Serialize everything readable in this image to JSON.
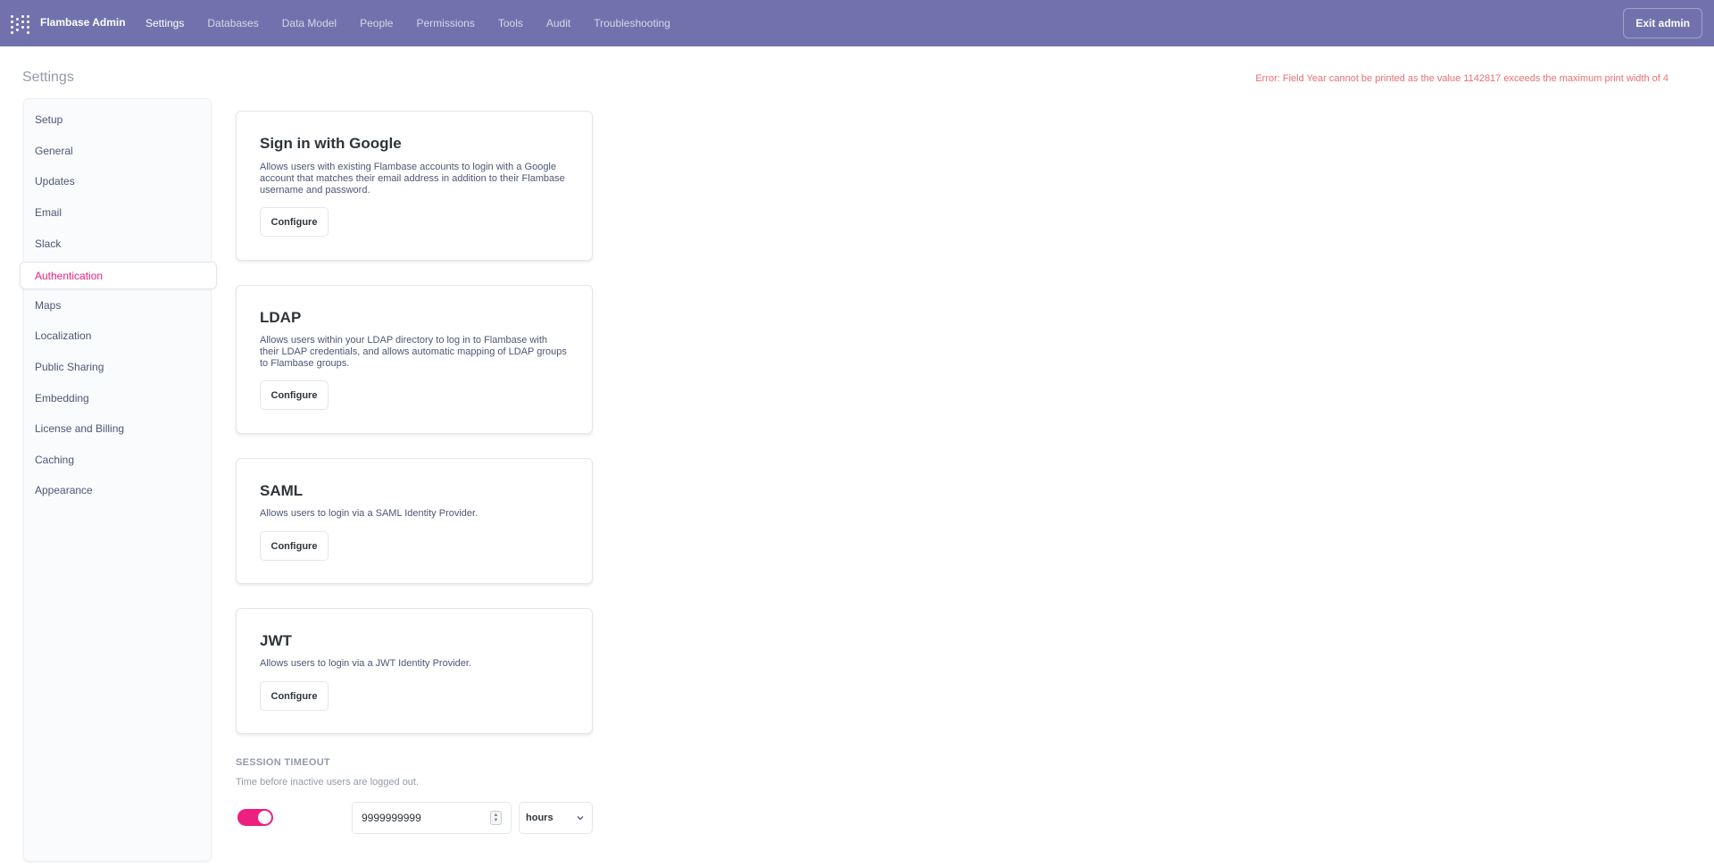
{
  "topnav": {
    "brand": "Flambase Admin",
    "links": [
      "Settings",
      "Databases",
      "Data Model",
      "People",
      "Permissions",
      "Tools",
      "Audit",
      "Troubleshooting"
    ],
    "exit_label": "Exit admin",
    "bg_color": "#7172ad"
  },
  "page": {
    "title": "Settings",
    "error": "Error: Field Year cannot be printed as the value 1142817 exceeds the maximum print width of 4"
  },
  "sidebar": {
    "items": [
      "Setup",
      "General",
      "Updates",
      "Email",
      "Slack",
      "Authentication",
      "Maps",
      "Localization",
      "Public Sharing",
      "Embedding",
      "License and Billing",
      "Caching",
      "Appearance"
    ],
    "active": "Authentication",
    "accent_color": "#ed1f7f"
  },
  "cards": [
    {
      "title": "Sign in with Google",
      "desc_lines": [
        "Allows users with existing Flambase accounts to login with a Google",
        "account that matches their email address in addition to their Flambase",
        "username and password."
      ],
      "button": "Configure"
    },
    {
      "title": "LDAP",
      "desc_lines": [
        "Allows users within your LDAP directory to log in to Flambase with",
        "their LDAP credentials, and allows automatic mapping of LDAP groups",
        "to Flambase groups."
      ],
      "button": "Configure"
    },
    {
      "title": "SAML",
      "desc_lines": [
        "Allows users to login via a SAML Identity Provider."
      ],
      "button": "Configure"
    },
    {
      "title": "JWT",
      "desc_lines": [
        "Allows users to login via a JWT Identity Provider."
      ],
      "button": "Configure"
    }
  ],
  "session_timeout": {
    "title": "SESSION TIMEOUT",
    "description": "Time before inactive users are logged out.",
    "enabled": true,
    "value": "9999999999",
    "unit": "hours"
  }
}
